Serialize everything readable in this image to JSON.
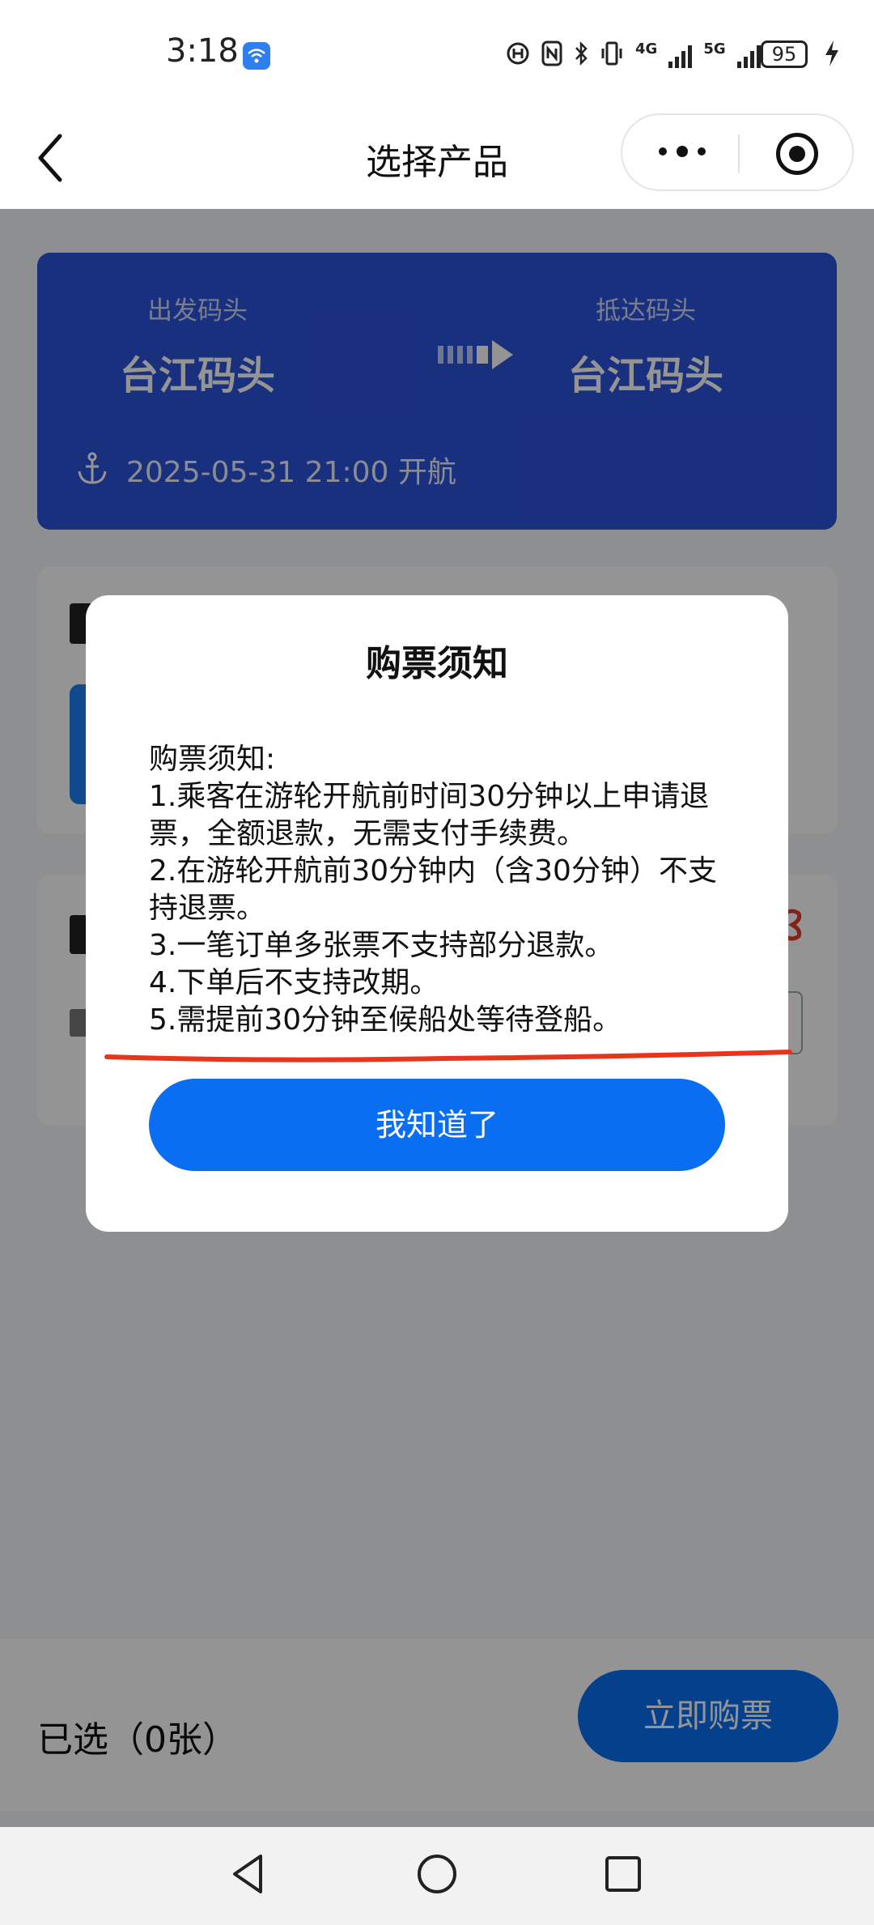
{
  "status_bar": {
    "time": "3:18",
    "battery": "95",
    "network_1": "4G",
    "network_2": "5G"
  },
  "nav": {
    "title": "选择产品"
  },
  "route": {
    "depart_label": "出发码头",
    "depart_port": "台江码头",
    "arrive_label": "抵达码头",
    "arrive_port": "台江码头",
    "departure": "2025-05-31 21:00 开航"
  },
  "bottom": {
    "selected": "已选（0张）",
    "buy_label": "立即购票"
  },
  "modal": {
    "title": "购票须知",
    "lines": [
      "购票须知:",
      "1.乘客在游轮开航前时间30分钟以上申请退票，全额退款，无需支付手续费。",
      "2.在游轮开航前30分钟内（含30分钟）不支持退票。",
      "3.一笔订单多张票不支持部分退款。",
      "4.下单后不支持改期。",
      "5.需提前30分钟至候船处等待登船。"
    ],
    "ok_label": "我知道了"
  },
  "colors": {
    "primary_blue": "#0a6ef2",
    "route_card": "#2c53d9",
    "annotation_red": "#e8341c"
  }
}
